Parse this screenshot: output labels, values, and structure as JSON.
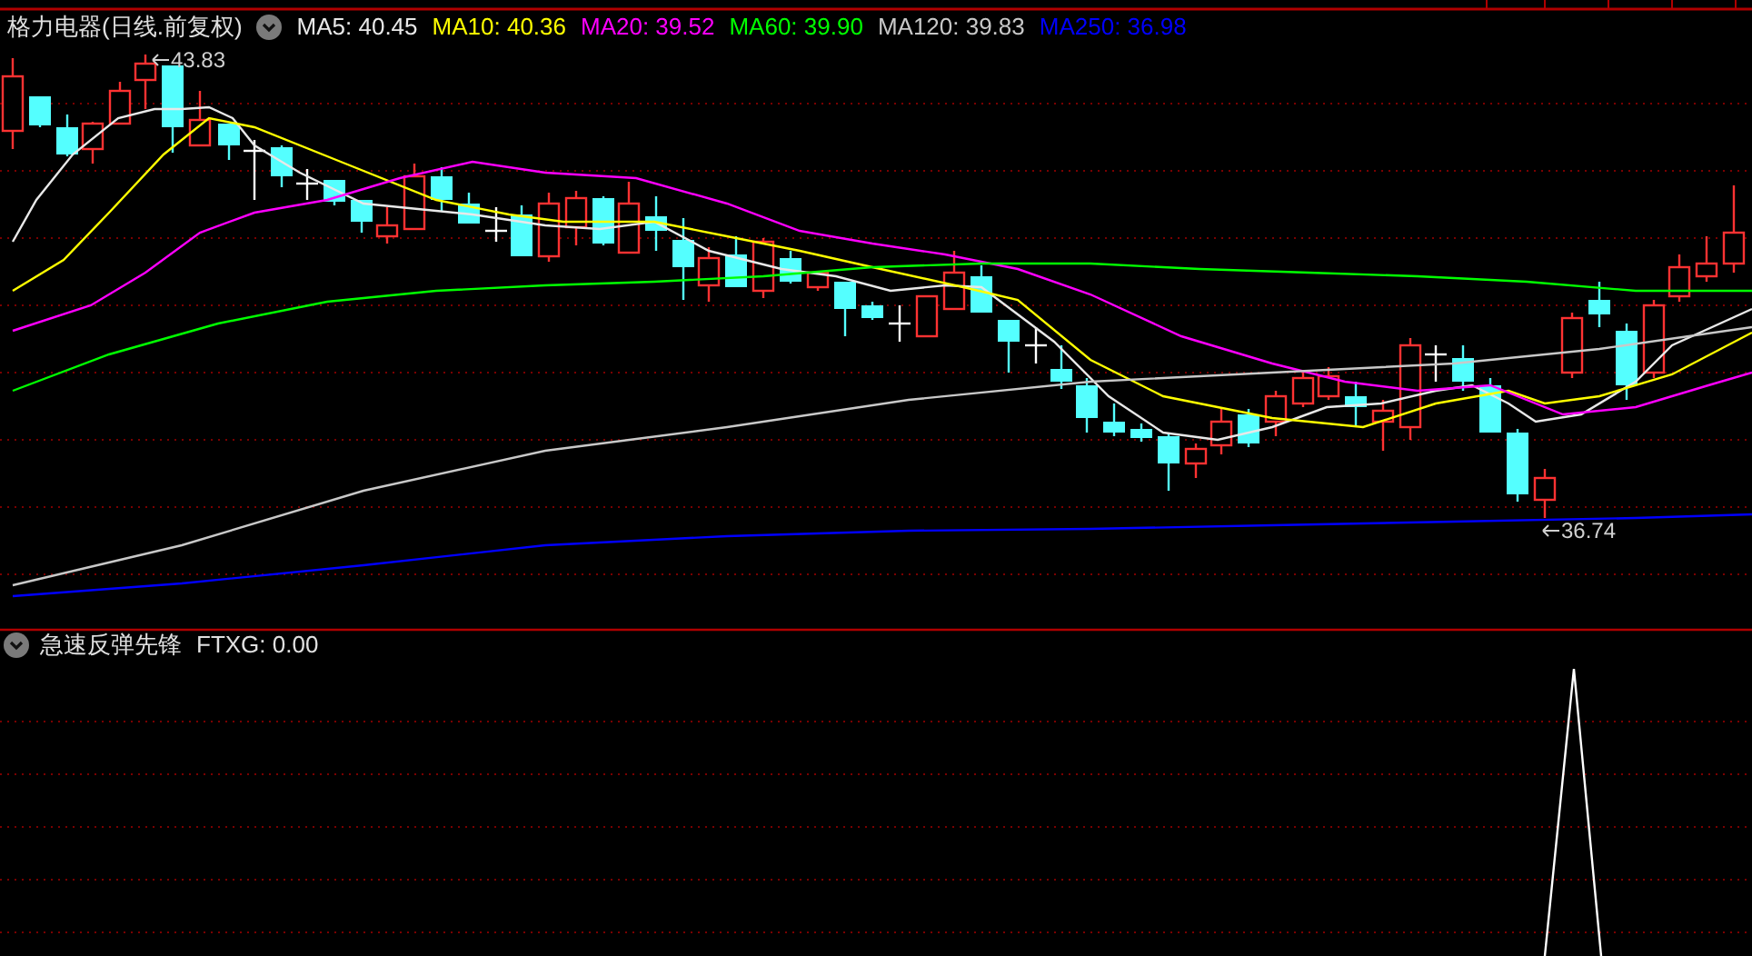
{
  "header": {
    "title": "格力电器(日线.前复权)",
    "indicators": [
      {
        "label": "MA5: 40.45",
        "color": "#e8e8e8"
      },
      {
        "label": "MA10: 40.36",
        "color": "#ffff00"
      },
      {
        "label": "MA20: 39.52",
        "color": "#ff00ff"
      },
      {
        "label": "MA60: 39.90",
        "color": "#00ff00"
      },
      {
        "label": "MA120: 39.83",
        "color": "#c8c8c8"
      },
      {
        "label": "MA250: 36.98",
        "color": "#0000ff"
      }
    ]
  },
  "price_chart": {
    "high_label": "43.83",
    "low_label": "36.74"
  },
  "indicator_pane": {
    "title": "急速反弹先锋",
    "reading": "FTXG: 0.00"
  }
}
